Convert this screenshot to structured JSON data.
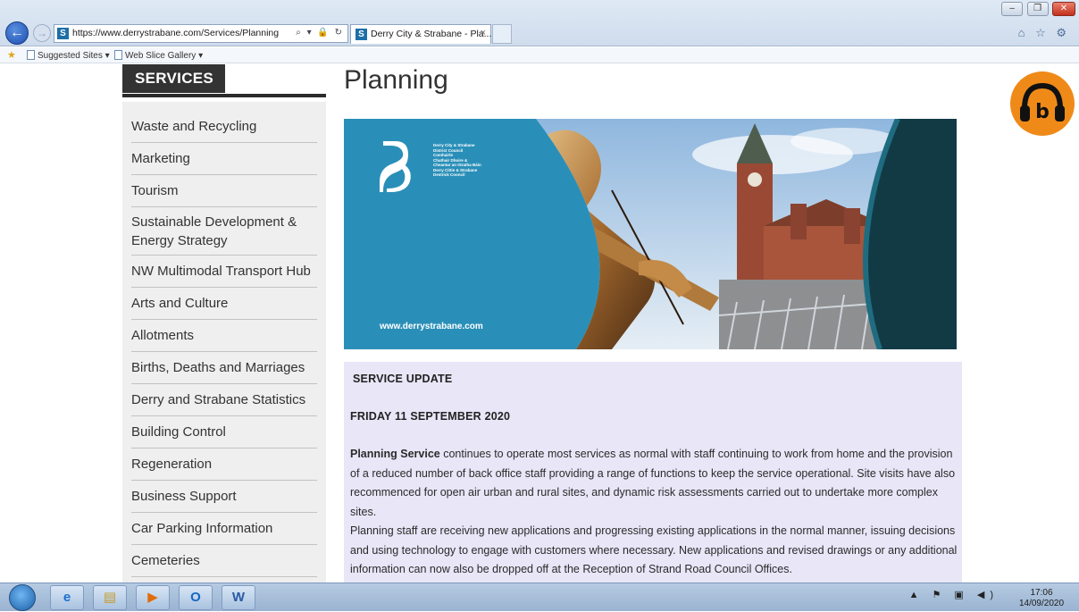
{
  "browser": {
    "url": "https://www.derrystrabane.com/Services/Planning",
    "address_icons": "⌕ ▾ 🔒 ↻",
    "tab_title": "Derry City & Strabane - Pla...",
    "tab_close": "×",
    "favicon_letter": "S",
    "favorites": {
      "suggested_sites": "Suggested Sites ▾",
      "web_slice_gallery": "Web Slice Gallery ▾"
    },
    "window_controls": {
      "minimize": "–",
      "restore": "❐",
      "close": "✕"
    },
    "toolbar_icons": "⌂ ☆ ⚙"
  },
  "sidebar": {
    "title": "SERVICES",
    "items": [
      {
        "label": "Waste and Recycling"
      },
      {
        "label": "Marketing"
      },
      {
        "label": "Tourism"
      },
      {
        "label": "Sustainable Development & Energy Strategy"
      },
      {
        "label": "NW Multimodal Transport Hub"
      },
      {
        "label": "Arts and Culture"
      },
      {
        "label": "Allotments"
      },
      {
        "label": "Births, Deaths and Marriages"
      },
      {
        "label": "Derry and Strabane Statistics"
      },
      {
        "label": "Building Control"
      },
      {
        "label": "Regeneration"
      },
      {
        "label": "Business Support"
      },
      {
        "label": "Car Parking Information"
      },
      {
        "label": "Cemeteries"
      }
    ]
  },
  "main": {
    "page_title": "Planning",
    "banner": {
      "council_lines": [
        "Derry City & Strabane",
        "District Council",
        "Comhairle",
        "Chathair Dhoire &",
        "Cheantar an tSratha Báin",
        "Derry Cittie & Strabane",
        "Destrick Cooncil"
      ],
      "website": "www.derrystrabane.com"
    },
    "update": {
      "heading": "SERVICE UPDATE",
      "date": "FRIDAY 11 SEPTEMBER 2020",
      "para1_bold": "Planning Service",
      "para1_rest": " continues to operate most services as normal with staff continuing to work from home and the provision of a reduced number of back office staff providing a range of functions to keep the service operational. Site visits have also recommenced for open air urban and rural sites, and dynamic risk assessments carried out to undertake more complex sites.",
      "para2": "Planning staff are receiving new applications and progressing existing applications in the normal manner, issuing decisions and using technology to engage with customers where necessary.  New applications and revised drawings or any additional information can now also be dropped off at the Reception of Strand Road Council Offices."
    },
    "audio_button_letter": "b"
  },
  "taskbar": {
    "tray_icons": "▲ ⚑ ▣ ◀)",
    "time": "17:06",
    "date": "14/09/2020",
    "app_labels": {
      "ie": "e",
      "explorer": "▤",
      "media": "▶",
      "outlook": "O",
      "word": "W"
    }
  },
  "colors": {
    "sidebar_bg": "#efefef",
    "title_box": "#333333",
    "banner_blue": "#2a8fb8",
    "update_bg": "#e8e6f7",
    "audio_orange": "#ef8a19"
  }
}
